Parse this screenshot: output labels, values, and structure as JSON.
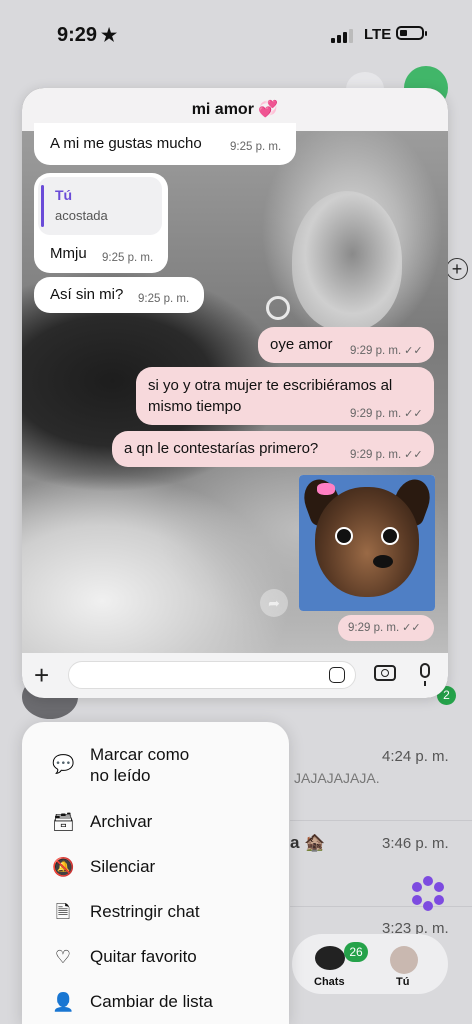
{
  "status_bar": {
    "time": "9:29",
    "star": "★",
    "network": "LTE"
  },
  "chat": {
    "title": "mi amor 💞",
    "messages": [
      {
        "text": "A mi me gustas mucho",
        "time": "9:25 p. m."
      },
      {
        "quote_name": "Tú",
        "quote_text": "acostada",
        "text": "Mmju",
        "time": "9:25 p. m."
      },
      {
        "text": "Así sin mi?",
        "time": "9:25 p. m."
      },
      {
        "text": "oye amor",
        "time": "9:29 p. m."
      },
      {
        "text": "si yo y otra mujer te escribiéramos al mismo tiempo",
        "time": "9:29 p. m."
      },
      {
        "text": "a qn le contestarías primero?",
        "time": "9:29 p. m."
      },
      {
        "text": "",
        "time": "9:29 p. m."
      }
    ],
    "composer": {
      "plus": "+",
      "placeholder": ""
    }
  },
  "background_list": {
    "unread_count": "2",
    "rows": [
      {
        "time": "4:24 p. m.",
        "preview": "JAJAJAJAJA."
      },
      {
        "time": "3:46 p. m.",
        "name_fragment": "a 🏚️"
      },
      {
        "time": "3:23 p. m."
      }
    ]
  },
  "menu": {
    "items": [
      {
        "icon": "💬",
        "label_line1": "Marcar como",
        "label_line2": "no leído"
      },
      {
        "icon": "🗃",
        "label_line1": "Archivar"
      },
      {
        "icon": "🔕",
        "label_line1": "Silenciar"
      },
      {
        "icon": "🗎",
        "label_line1": "Restringir chat"
      },
      {
        "icon": "♡",
        "label_line1": "Quitar favorito"
      },
      {
        "icon": "👤",
        "label_line1": "Cambiar de lista"
      }
    ]
  },
  "tabbar": {
    "chats_label": "Chats",
    "chats_badge": "26",
    "you_label": "Tú"
  },
  "colors": {
    "accent_green": "#25a24a",
    "outgoing_bubble": "#f7d9dc",
    "quote_purple": "#6a4bd8"
  }
}
